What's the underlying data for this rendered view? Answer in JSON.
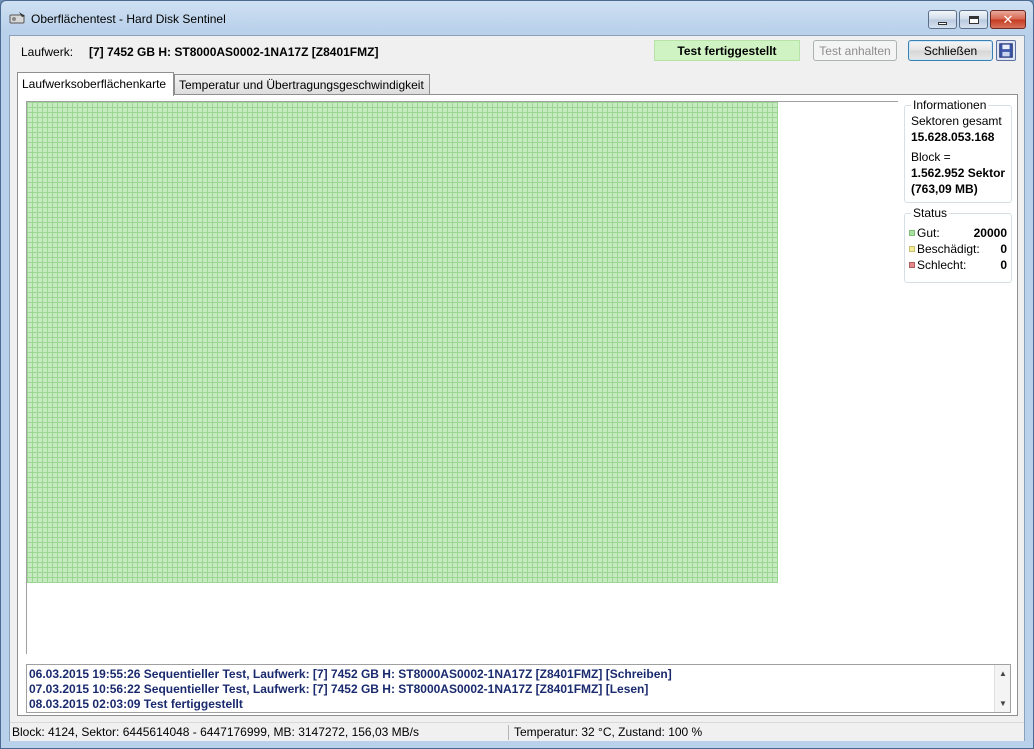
{
  "window": {
    "title": "Oberflächentest - Hard Disk Sentinel",
    "app_icon": "hdd-sentinel-icon"
  },
  "toolbar": {
    "drive_label": "Laufwerk:",
    "drive_value": "[7] 7452 GB H: ST8000AS0002-1NA17Z [Z8401FMZ]",
    "test_status": "Test fertiggestellt",
    "pause_button": "Test anhalten",
    "close_button": "Schließen",
    "save_icon": "floppy-disk-icon"
  },
  "tabs": [
    {
      "label": "Laufwerksoberflächenkarte",
      "active": true
    },
    {
      "label": "Temperatur und Übertragungsgeschwindigkeit",
      "active": false
    }
  ],
  "surface_map": {
    "block_color": "#c6ebc0",
    "blocks_good": 20000
  },
  "info": {
    "legend": "Informationen",
    "sectors_label": "Sektoren gesamt",
    "sectors_value": "15.628.053.168",
    "block_label": "Block =",
    "block_value": "1.562.952 Sektor",
    "block_size": "(763,09 MB)"
  },
  "status": {
    "legend": "Status",
    "rows": [
      {
        "label": "Gut:",
        "value": "20000",
        "color": "#a8e0a0"
      },
      {
        "label": "Beschädigt:",
        "value": "0",
        "color": "#f2ec9a"
      },
      {
        "label": "Schlecht:",
        "value": "0",
        "color": "#e08a8a"
      }
    ]
  },
  "log": [
    "06.03.2015  19:55:26  Sequentieller Test, Laufwerk: [7] 7452 GB H: ST8000AS0002-1NA17Z [Z8401FMZ] [Schreiben]",
    "07.03.2015  10:56:22  Sequentieller Test, Laufwerk: [7] 7452 GB H: ST8000AS0002-1NA17Z [Z8401FMZ] [Lesen]",
    "08.03.2015  02:03:09  Test fertiggestellt"
  ],
  "statusbar": {
    "left": "Block: 4124, Sektor: 6445614048 - 6447176999, MB: 3147272, 156,03 MB/s",
    "right": "Temperatur: 32  °C,  Zustand: 100 %"
  }
}
